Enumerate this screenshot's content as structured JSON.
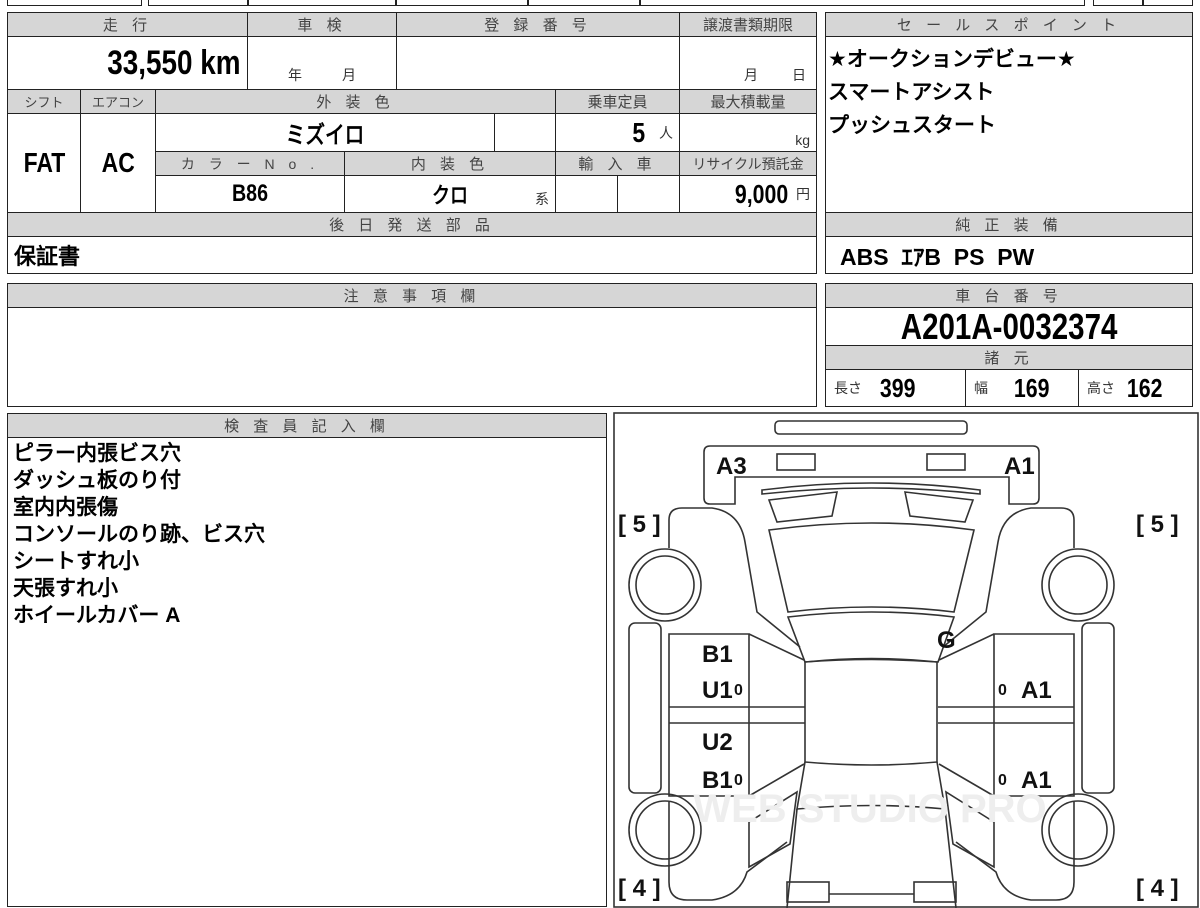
{
  "top": {
    "mileage": {
      "label": "走 行",
      "value": "33,550",
      "unit": "km"
    },
    "inspection": {
      "label": "車 検",
      "year": "年",
      "month": "月"
    },
    "registration": {
      "label": "登 録 番 号",
      "value": ""
    },
    "transfer_deadline": {
      "label": "譲渡書類期限",
      "month": "月",
      "day": "日"
    },
    "shift": {
      "label": "シフト",
      "value": "FAT"
    },
    "aircon": {
      "label": "エアコン",
      "value": "AC"
    },
    "exterior_color": {
      "label": "外 装 色",
      "value": "ミズイロ"
    },
    "capacity": {
      "label": "乗車定員",
      "value": "5",
      "unit": "人"
    },
    "max_load": {
      "label": "最大積載量",
      "unit": "kg"
    },
    "color_no": {
      "label": "カ ラ ー N o .",
      "value": "B86"
    },
    "interior_color": {
      "label": "内 装 色",
      "value": "クロ",
      "suffix": "系"
    },
    "import": {
      "label": "輸 入 車"
    },
    "recycle": {
      "label": "リサイクル預託金",
      "value": "9,000",
      "unit": "円"
    },
    "later_parts": {
      "label": "後 日 発 送 部 品",
      "value": "保証書"
    }
  },
  "sales_points": {
    "label": "セ ー ル ス ポ イ ン ト",
    "items": [
      "★オークションデビュー★",
      "スマートアシスト",
      "プッシュスタート"
    ]
  },
  "equipment": {
    "label": "純 正 装 備",
    "value": "ABS  ｴｱB  PS  PW"
  },
  "notes": {
    "label": "注 意 事 項 欄",
    "value": ""
  },
  "chassis": {
    "label": "車 台 番 号",
    "value": "A201A-0032374"
  },
  "specs": {
    "label": "諸 元",
    "length_label": "長さ",
    "length": "399",
    "width_label": "幅",
    "width": "169",
    "height_label": "高さ",
    "height": "162"
  },
  "inspector": {
    "label": "検 査 員 記 入 欄",
    "lines": [
      "ピラー内張ビス穴",
      "ダッシュ板のり付",
      "室内内張傷",
      "コンソールのり跡、ビス穴",
      "シートすれ小",
      "天張すれ小",
      "ホイールカバー A"
    ]
  },
  "diagram": {
    "front_left": "A3",
    "front_right": "A1",
    "score_fl": "[ 5 ]",
    "score_fr": "[ 5 ]",
    "score_rl": "[ 4 ]",
    "score_rr": "[ 4 ]",
    "roof": "G",
    "left_front_door": "B1",
    "left_front_sill": "U1",
    "left_rear_door": "U2",
    "left_rear_sill": "B1",
    "right_front": "A1",
    "right_rear": "A1",
    "zero": "0",
    "watermark": "WEB STUDIO PRO"
  }
}
